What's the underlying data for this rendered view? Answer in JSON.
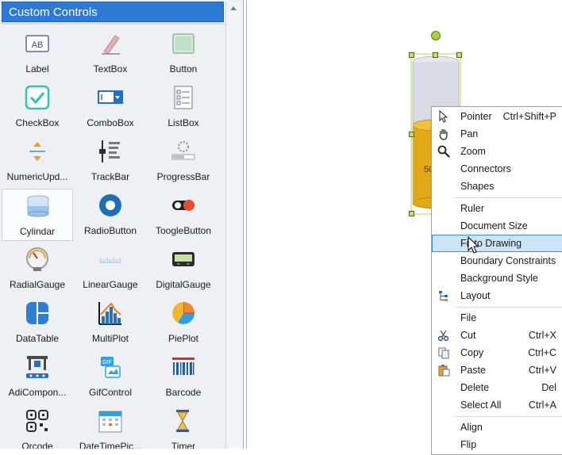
{
  "toolbox": {
    "title": "Custom Controls",
    "items": [
      {
        "label": "Label",
        "icon": "label-icon"
      },
      {
        "label": "TextBox",
        "icon": "textbox-icon"
      },
      {
        "label": "Button",
        "icon": "button-icon"
      },
      {
        "label": "CheckBox",
        "icon": "checkbox-icon"
      },
      {
        "label": "ComboBox",
        "icon": "combobox-icon"
      },
      {
        "label": "ListBox",
        "icon": "listbox-icon"
      },
      {
        "label": "NumericUpd...",
        "icon": "numeric-updown-icon"
      },
      {
        "label": "TrackBar",
        "icon": "trackbar-icon"
      },
      {
        "label": "ProgressBar",
        "icon": "progressbar-icon"
      },
      {
        "label": "Cylindar",
        "icon": "cylinder-icon"
      },
      {
        "label": "RadioButton",
        "icon": "radiobutton-icon"
      },
      {
        "label": "ToogleButton",
        "icon": "toggle-icon"
      },
      {
        "label": "RadialGauge",
        "icon": "radial-gauge-icon"
      },
      {
        "label": "LinearGauge",
        "icon": "linear-gauge-icon"
      },
      {
        "label": "DigitalGauge",
        "icon": "digital-gauge-icon"
      },
      {
        "label": "DataTable",
        "icon": "datatable-icon"
      },
      {
        "label": "MultiPlot",
        "icon": "multiplot-icon"
      },
      {
        "label": "PiePlot",
        "icon": "pieplot-icon"
      },
      {
        "label": "AdiCompon...",
        "icon": "adi-component-icon"
      },
      {
        "label": "GifControl",
        "icon": "gif-icon"
      },
      {
        "label": "Barcode",
        "icon": "barcode-icon"
      },
      {
        "label": "Qrcode",
        "icon": "qrcode-icon"
      },
      {
        "label": "DateTimePic...",
        "icon": "calendar-icon"
      },
      {
        "label": "Timer",
        "icon": "timer-icon"
      }
    ],
    "selected_index": 9
  },
  "canvas": {
    "cylinder_value_text": "50",
    "cylinder_fill_level": 0.5
  },
  "context_menu": {
    "items": [
      {
        "label": "Pointer",
        "shortcut": "Ctrl+Shift+P",
        "icon": "pointer-icon"
      },
      {
        "label": "Pan",
        "shortcut": "",
        "icon": "hand-icon"
      },
      {
        "label": "Zoom",
        "shortcut": "",
        "icon": "magnifier-icon"
      },
      {
        "label": "Connectors",
        "shortcut": "",
        "icon": ""
      },
      {
        "label": "Shapes",
        "shortcut": "",
        "icon": ""
      },
      {
        "label": "Ruler",
        "shortcut": "",
        "icon": ""
      },
      {
        "label": "Document Size",
        "shortcut": "",
        "icon": ""
      },
      {
        "label": "Fit to Drawing",
        "shortcut": "",
        "icon": ""
      },
      {
        "label": "Boundary Constraints",
        "shortcut": "",
        "icon": ""
      },
      {
        "label": "Background Style",
        "shortcut": "",
        "icon": ""
      },
      {
        "label": "Layout",
        "shortcut": "",
        "icon": "layout-icon"
      },
      {
        "label": "File",
        "shortcut": "",
        "icon": ""
      },
      {
        "label": "Cut",
        "shortcut": "Ctrl+X",
        "icon": "scissors-icon"
      },
      {
        "label": "Copy",
        "shortcut": "Ctrl+C",
        "icon": "copy-icon"
      },
      {
        "label": "Paste",
        "shortcut": "Ctrl+V",
        "icon": "paste-icon"
      },
      {
        "label": "Delete",
        "shortcut": "Del",
        "icon": ""
      },
      {
        "label": "Select All",
        "shortcut": "Ctrl+A",
        "icon": ""
      },
      {
        "label": "Align",
        "shortcut": "",
        "icon": ""
      },
      {
        "label": "Flip",
        "shortcut": "",
        "icon": ""
      }
    ],
    "highlighted_index": 7
  },
  "colors": {
    "header_blue": "#2b7bd6",
    "cylinder_fill": "#e2a917",
    "cylinder_body": "#d8dae4",
    "selection_handle": "#c8e06a",
    "menu_highlight": "#cce4f7"
  }
}
